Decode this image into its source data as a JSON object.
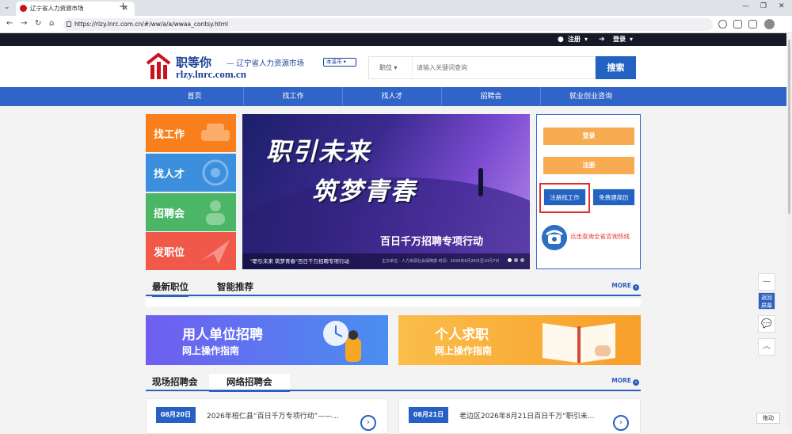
{
  "browser": {
    "tab_title": "辽宁省人力资源市场",
    "url": "https://rlzy.lnrc.com.cn/#/ww/a/a/wwaa_contsy.html"
  },
  "topbar": {
    "register": "注册",
    "login": "登录"
  },
  "logo": {
    "title": "职等你",
    "subtitle": "— 辽宁省人力资源市场",
    "domain": "rlzy.lnrc.com.cn",
    "city_selector": "本溪市"
  },
  "search": {
    "category": "职位",
    "placeholder": "请输入关键词查询",
    "button": "搜索"
  },
  "nav": [
    "首页",
    "找工作",
    "找人才",
    "招聘会",
    "就业创业咨询"
  ],
  "tiles": [
    {
      "label": "找工作",
      "color": "#f97f1c"
    },
    {
      "label": "找人才",
      "color": "#3c8fdc"
    },
    {
      "label": "招聘会",
      "color": "#4bb766"
    },
    {
      "label": "发职位",
      "color": "#f0584a"
    }
  ],
  "banner": {
    "title_line1": "职引未来",
    "title_line2": "筑梦青春",
    "slogan": "百日千万招聘专项行动",
    "caption": "\"职引未来 筑梦青春\"百日千万招聘专项行动",
    "meta": "主办单位：人力资源社会保障部    时间：2026年6月26日至10月7日"
  },
  "panel": {
    "login": "登录",
    "register": "注册",
    "register_job": "注册找工作",
    "free_resume": "免费建简历",
    "hotline": "点击查询全省咨询热线"
  },
  "jobs_section": {
    "tab1": "最新职位",
    "tab2": "智能推荐",
    "more": "MORE"
  },
  "guides": [
    {
      "title": "用人单位招聘",
      "subtitle": "网上操作指南"
    },
    {
      "title": "个人求职",
      "subtitle": "网上操作指南"
    }
  ],
  "fairs_section": {
    "tab1": "现场招聘会",
    "tab2": "网络招聘会",
    "more": "MORE"
  },
  "fair_cards": [
    {
      "date": "08月20日",
      "title": "2026年桓仁县“百日千万专项行动”——..."
    },
    {
      "date": "08月21日",
      "title": "老边区2026年8月21日百日千万“职引未..."
    }
  ],
  "side": {
    "back_top": "返回屏幕",
    "motion": "拖动"
  }
}
